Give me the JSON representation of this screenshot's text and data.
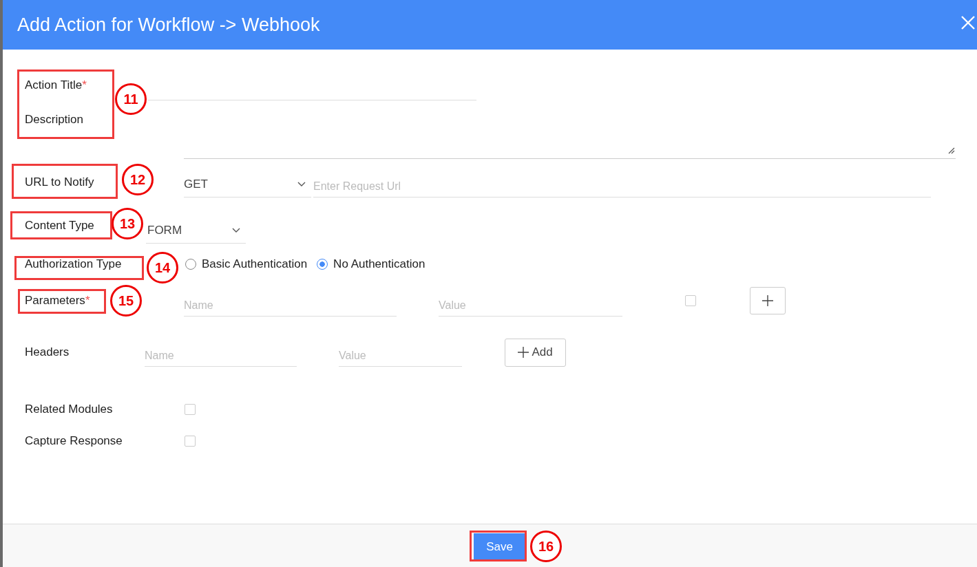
{
  "dialog": {
    "title": "Add Action for Workflow -> Webhook"
  },
  "action_title": {
    "label": "Action Title",
    "required_mark": "*"
  },
  "description": {
    "label": "Description"
  },
  "url": {
    "label": "URL to Notify",
    "method": "GET",
    "placeholder": "Enter Request Url"
  },
  "content_type": {
    "label": "Content Type",
    "value": "FORM"
  },
  "authorization": {
    "label": "Authorization Type",
    "options": [
      {
        "label": "Basic Authentication",
        "selected": false
      },
      {
        "label": "No Authentication",
        "selected": true
      }
    ]
  },
  "parameters": {
    "label": "Parameters",
    "required_mark": "*",
    "name_placeholder": "Name",
    "value_placeholder": "Value",
    "checked": false
  },
  "headers": {
    "label": "Headers",
    "name_placeholder": "Name",
    "value_placeholder": "Value",
    "add_button": "Add"
  },
  "options": [
    {
      "label": "Related Modules",
      "checked": false
    },
    {
      "label": "Capture Response",
      "checked": false
    }
  ],
  "save_button": "Save",
  "annotations": [
    {
      "number": "11"
    },
    {
      "number": "12"
    },
    {
      "number": "13"
    },
    {
      "number": "14"
    },
    {
      "number": "15"
    },
    {
      "number": "16"
    }
  ]
}
